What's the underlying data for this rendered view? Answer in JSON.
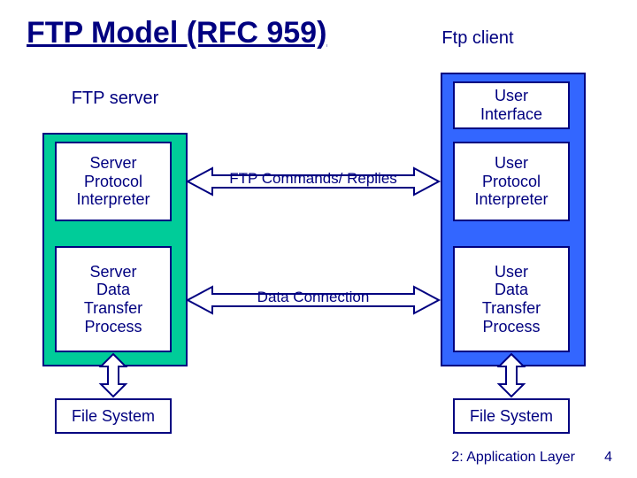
{
  "title": "FTP Model (RFC 959)",
  "labels": {
    "server": "FTP server",
    "client": "Ftp client"
  },
  "server": {
    "spi": "Server\nProtocol\nInterpreter",
    "sdtp": "Server\nData\nTransfer\nProcess",
    "fs": "File System"
  },
  "client": {
    "ui": "User\nInterface",
    "upi": "User\nProtocol\nInterpreter",
    "udtp": "User\nData\nTransfer\nProcess",
    "fs": "File System"
  },
  "connections": {
    "commands": "FTP Commands/ Replies",
    "data": "Data Connection"
  },
  "footer": {
    "chapter": "2: Application Layer",
    "page": "4"
  }
}
